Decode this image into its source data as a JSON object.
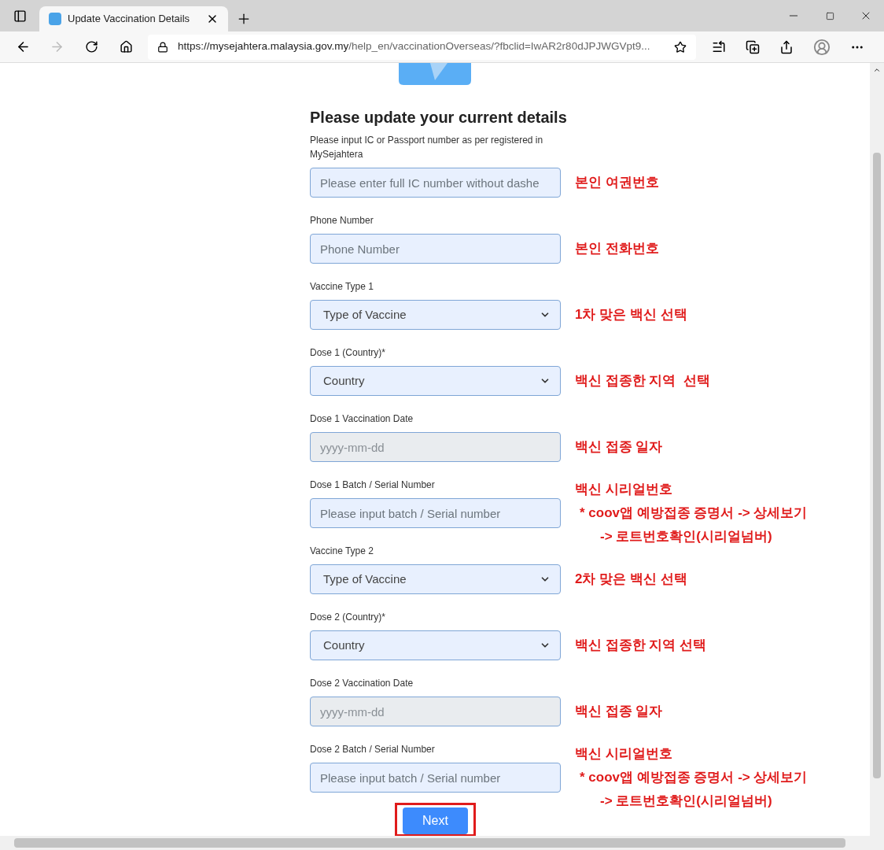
{
  "browser": {
    "tab_title": "Update Vaccination Details",
    "url_host": "https://mysejahtera.malaysia.gov.my",
    "url_path": "/help_en/vaccinationOverseas/?fbclid=IwAR2r80dJPJWGVpt9..."
  },
  "form": {
    "title": "Please update your current details",
    "fields": [
      {
        "kind": "text",
        "label": "Please input IC or Passport number as per registered in MySejahtera",
        "placeholder": "Please enter full IC number without dashe",
        "annotation": [
          "본인 여권번호"
        ]
      },
      {
        "kind": "text",
        "label": "Phone Number",
        "placeholder": "Phone Number",
        "annotation": [
          "본인 전화번호"
        ]
      },
      {
        "kind": "select",
        "label": "Vaccine Type 1",
        "value": "Type of Vaccine",
        "annotation": [
          "1차 맞은 백신 선택"
        ]
      },
      {
        "kind": "select",
        "label": "Dose 1 (Country)*",
        "value": "Country",
        "annotation": [
          "백신 접종한 지역  선택"
        ]
      },
      {
        "kind": "date",
        "label": "Dose 1 Vaccination Date",
        "placeholder": "yyyy-mm-dd",
        "annotation": [
          "백신 접종 일자"
        ]
      },
      {
        "kind": "text",
        "label": "Dose 1 Batch / Serial Number",
        "placeholder": "Please input batch / Serial number",
        "annotation": [
          "백신 시리얼번호",
          "* coov앱 예방접종 증명서 -> 상세보기",
          "-> 로트번호확인(시리얼넘버)"
        ]
      },
      {
        "kind": "select",
        "label": "Vaccine Type 2",
        "value": "Type of Vaccine",
        "annotation": [
          "2차 맞은 백신 선택"
        ]
      },
      {
        "kind": "select",
        "label": "Dose 2 (Country)*",
        "value": "Country",
        "annotation": [
          "백신 접종한 지역 선택"
        ]
      },
      {
        "kind": "date",
        "label": "Dose 2 Vaccination Date",
        "placeholder": "yyyy-mm-dd",
        "annotation": [
          "백신 접종 일자"
        ]
      },
      {
        "kind": "text",
        "label": "Dose 2 Batch / Serial Number",
        "placeholder": "Please input batch / Serial number",
        "annotation": [
          "백신 시리얼번호",
          "* coov앱 예방접종 증명서 -> 상세보기",
          "-> 로트번호확인(시리얼넘버)"
        ]
      }
    ],
    "next_button": "Next"
  }
}
